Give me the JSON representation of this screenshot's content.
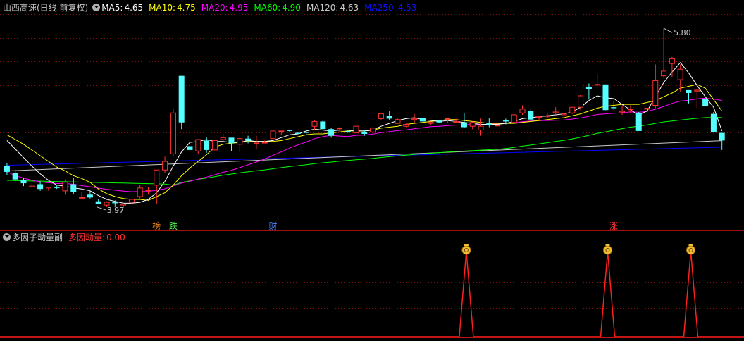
{
  "header": {
    "stock_title": "山西高速(日线 前复权)",
    "ma": [
      {
        "label": "MA5:",
        "value": "4.65",
        "color": "#ffffff"
      },
      {
        "label": "MA10:",
        "value": "4.75",
        "color": "#ffff00"
      },
      {
        "label": "MA20:",
        "value": "4.95",
        "color": "#ff00ff"
      },
      {
        "label": "MA60:",
        "value": "4.90",
        "color": "#00ff00"
      },
      {
        "label": "MA120:",
        "value": "4.63",
        "color": "#c8c8c8"
      },
      {
        "label": "MA250:",
        "value": "4.53",
        "color": "#0000ff"
      }
    ]
  },
  "sub_header": {
    "indicator_title": "多因子动量副",
    "indicator_label": "多因动量:",
    "indicator_value": "0.00"
  },
  "colors": {
    "up": "#ff3232",
    "down": "#54ffff",
    "grid": "#841010",
    "ma5": "#ffffff",
    "ma10": "#ffff00",
    "ma20": "#ff00ff",
    "ma60": "#00ff00",
    "ma120": "#c8c8c8",
    "ma250": "#0000ff"
  },
  "chart_data": {
    "type": "candlestick",
    "ylim": [
      3.8,
      5.95
    ],
    "x": [
      0,
      1,
      2,
      3,
      4,
      5,
      6,
      7,
      8,
      9,
      10,
      11,
      12,
      13,
      14,
      15,
      16,
      17,
      18,
      19,
      20,
      21,
      22,
      23,
      24,
      25,
      26,
      27,
      28,
      29,
      30,
      31,
      32,
      33,
      34,
      35,
      36,
      37,
      38,
      39,
      40,
      41,
      42,
      43,
      44,
      45,
      46,
      47,
      48,
      49,
      50,
      51,
      52,
      53,
      54,
      55,
      56,
      57,
      58,
      59,
      60,
      61,
      62,
      63,
      64,
      65,
      66,
      67,
      68,
      69,
      70,
      71,
      72,
      73,
      74,
      75,
      76,
      77,
      78,
      79,
      80,
      81,
      82,
      83,
      84,
      85,
      86
    ],
    "ohlc": [
      [
        4.35,
        4.38,
        4.26,
        4.29
      ],
      [
        4.28,
        4.31,
        4.19,
        4.21
      ],
      [
        4.2,
        4.23,
        4.14,
        4.17
      ],
      [
        4.13,
        4.16,
        4.12,
        4.14
      ],
      [
        4.16,
        4.19,
        4.09,
        4.11
      ],
      [
        4.12,
        4.13,
        4.09,
        4.13
      ],
      [
        4.13,
        4.15,
        4.11,
        4.12
      ],
      [
        4.09,
        4.21,
        4.05,
        4.18
      ],
      [
        4.16,
        4.23,
        4.06,
        4.08
      ],
      [
        4.02,
        4.08,
        4.0,
        4.02
      ],
      [
        4.05,
        4.09,
        4.01,
        4.02
      ],
      [
        3.98,
        4.0,
        3.95,
        3.95
      ],
      [
        3.94,
        3.98,
        3.92,
        3.97
      ],
      [
        3.97,
        3.99,
        3.92,
        3.96
      ],
      [
        3.94,
        3.97,
        3.91,
        3.95
      ],
      [
        3.97,
        4.0,
        3.95,
        4.0
      ],
      [
        4.03,
        4.15,
        4.01,
        4.12
      ],
      [
        4.1,
        4.13,
        4.05,
        4.1
      ],
      [
        4.15,
        4.3,
        3.95,
        4.31
      ],
      [
        4.31,
        4.45,
        4.28,
        4.4
      ],
      [
        4.48,
        4.95,
        4.45,
        4.91
      ],
      [
        5.3,
        5.3,
        4.74,
        4.81
      ],
      [
        4.56,
        4.58,
        4.52,
        4.52
      ],
      [
        4.51,
        4.63,
        4.48,
        4.63
      ],
      [
        4.62,
        4.66,
        4.49,
        4.52
      ],
      [
        4.52,
        4.62,
        4.52,
        4.62
      ],
      [
        4.63,
        4.69,
        4.61,
        4.65
      ],
      [
        4.65,
        4.63,
        4.51,
        4.59
      ],
      [
        4.58,
        4.65,
        4.5,
        4.64
      ],
      [
        4.64,
        4.67,
        4.59,
        4.62
      ],
      [
        4.59,
        4.67,
        4.53,
        4.6
      ],
      [
        4.6,
        4.62,
        4.59,
        4.6
      ],
      [
        4.64,
        4.74,
        4.55,
        4.72
      ],
      [
        4.72,
        4.71,
        4.68,
        4.72
      ],
      [
        4.73,
        4.73,
        4.71,
        4.72
      ],
      [
        4.7,
        4.71,
        4.71,
        4.69
      ],
      [
        4.71,
        4.73,
        4.68,
        4.7
      ],
      [
        4.77,
        4.83,
        4.73,
        4.82
      ],
      [
        4.82,
        4.83,
        4.73,
        4.74
      ],
      [
        4.74,
        4.75,
        4.65,
        4.67
      ],
      [
        4.75,
        4.76,
        4.72,
        4.75
      ],
      [
        4.72,
        4.73,
        4.7,
        4.71
      ],
      [
        4.7,
        4.79,
        4.69,
        4.77
      ],
      [
        4.71,
        4.73,
        4.67,
        4.69
      ],
      [
        4.71,
        4.76,
        4.7,
        4.75
      ],
      [
        4.85,
        4.9,
        4.84,
        4.9
      ],
      [
        4.88,
        4.93,
        4.83,
        4.85
      ],
      [
        4.8,
        4.85,
        4.8,
        4.84
      ],
      [
        4.77,
        4.8,
        4.76,
        4.79
      ],
      [
        4.84,
        4.9,
        4.8,
        4.85
      ],
      [
        4.86,
        4.86,
        4.82,
        4.82
      ],
      [
        4.8,
        4.82,
        4.78,
        4.81
      ],
      [
        4.83,
        4.83,
        4.81,
        4.81
      ],
      [
        4.85,
        4.86,
        4.81,
        4.85
      ],
      [
        4.82,
        4.85,
        4.81,
        4.82
      ],
      [
        4.81,
        4.91,
        4.75,
        4.76
      ],
      [
        4.77,
        4.82,
        4.74,
        4.81
      ],
      [
        4.73,
        4.85,
        4.67,
        4.77
      ],
      [
        4.8,
        4.86,
        4.76,
        4.78
      ],
      [
        4.78,
        4.79,
        4.78,
        4.78
      ],
      [
        4.83,
        4.85,
        4.79,
        4.82
      ],
      [
        4.81,
        4.91,
        4.8,
        4.89
      ],
      [
        4.91,
        4.99,
        4.89,
        4.95
      ],
      [
        4.93,
        4.95,
        4.87,
        4.84
      ],
      [
        4.87,
        4.88,
        4.83,
        4.87
      ],
      [
        4.87,
        4.91,
        4.86,
        4.88
      ],
      [
        4.91,
        4.97,
        4.89,
        4.92
      ],
      [
        4.89,
        4.91,
        4.87,
        4.9
      ],
      [
        4.91,
        4.97,
        4.9,
        4.97
      ],
      [
        4.97,
        5.1,
        4.94,
        5.09
      ],
      [
        5.18,
        5.22,
        5.05,
        5.16
      ],
      [
        5.21,
        5.32,
        5.21,
        5.21
      ],
      [
        5.21,
        5.21,
        4.94,
        4.94
      ],
      [
        4.97,
        5.04,
        4.94,
        4.96
      ],
      [
        4.92,
        4.99,
        4.89,
        4.93
      ],
      [
        4.95,
        4.99,
        4.91,
        4.95
      ],
      [
        4.91,
        4.92,
        4.72,
        4.72
      ],
      [
        4.95,
        4.95,
        4.9,
        4.96
      ],
      [
        4.99,
        5.42,
        4.96,
        5.25
      ],
      [
        5.3,
        5.8,
        5.28,
        5.35
      ],
      [
        5.43,
        5.5,
        5.29,
        5.48
      ],
      [
        5.26,
        5.42,
        5.13,
        5.37
      ],
      [
        5.15,
        5.15,
        5.01,
        5.12
      ],
      [
        5.14,
        5.16,
        4.96,
        5.15
      ],
      [
        5.06,
        5.04,
        5.06,
        4.98
      ],
      [
        4.9,
        4.92,
        4.81,
        4.71
      ],
      [
        4.7,
        4.68,
        4.52,
        4.62
      ]
    ],
    "ma": {
      "ma5": [
        4.62,
        4.53,
        4.44,
        4.35,
        4.27,
        4.2,
        4.15,
        4.14,
        4.12,
        4.11,
        4.09,
        4.04,
        4.0,
        3.98,
        3.96,
        3.96,
        3.97,
        4.0,
        4.07,
        4.19,
        4.35,
        4.5,
        4.6,
        4.61,
        4.63,
        4.61,
        4.61,
        4.6,
        4.6,
        4.62,
        4.61,
        4.61,
        4.62,
        4.65,
        4.68,
        4.69,
        4.72,
        4.74,
        4.73,
        4.72,
        4.73,
        4.73,
        4.72,
        4.72,
        4.73,
        4.77,
        4.8,
        4.83,
        4.85,
        4.86,
        4.84,
        4.83,
        4.82,
        4.83,
        4.82,
        4.81,
        4.8,
        4.79,
        4.79,
        4.79,
        4.8,
        4.82,
        4.85,
        4.86,
        4.87,
        4.88,
        4.89,
        4.9,
        4.92,
        4.97,
        5.04,
        5.09,
        5.07,
        5.06,
        5.0,
        4.94,
        4.89,
        4.93,
        5.08,
        5.23,
        5.34,
        5.44,
        5.33,
        5.2,
        5.08,
        4.97,
        4.72
      ],
      "ma10": [
        4.68,
        4.63,
        4.58,
        4.52,
        4.46,
        4.4,
        4.34,
        4.3,
        4.25,
        4.22,
        4.18,
        4.11,
        4.06,
        4.03,
        4.01,
        4.0,
        4.0,
        3.99,
        4.03,
        4.07,
        4.15,
        4.25,
        4.33,
        4.4,
        4.47,
        4.55,
        4.58,
        4.59,
        4.6,
        4.61,
        4.61,
        4.61,
        4.61,
        4.62,
        4.64,
        4.66,
        4.68,
        4.69,
        4.69,
        4.7,
        4.71,
        4.72,
        4.72,
        4.72,
        4.73,
        4.75,
        4.76,
        4.77,
        4.79,
        4.8,
        4.81,
        4.82,
        4.83,
        4.84,
        4.84,
        4.83,
        4.82,
        4.81,
        4.8,
        4.8,
        4.8,
        4.8,
        4.81,
        4.82,
        4.83,
        4.84,
        4.85,
        4.86,
        4.88,
        4.9,
        4.93,
        4.96,
        4.98,
        4.99,
        5.0,
        5.0,
        5.0,
        5.02,
        5.04,
        5.08,
        5.12,
        5.17,
        5.19,
        5.21,
        5.17,
        5.05,
        4.93
      ]
    }
  },
  "chart_labels": {
    "high_label": "5.80",
    "low_label": "3.97",
    "markers": [
      {
        "text": "榜",
        "color": "#ff8c1e"
      },
      {
        "text": "跌",
        "color": "#50ff50"
      },
      {
        "text": "财",
        "color": "#4f80ff"
      },
      {
        "text": "涨",
        "color": "#ff3030"
      }
    ]
  },
  "indicator_data": {
    "type": "line",
    "spikes": [
      {
        "x": 55,
        "value": 1
      },
      {
        "x": 72,
        "value": 1
      },
      {
        "x": 82,
        "value": 1
      }
    ],
    "marker_icon": "money-bag-icon"
  }
}
